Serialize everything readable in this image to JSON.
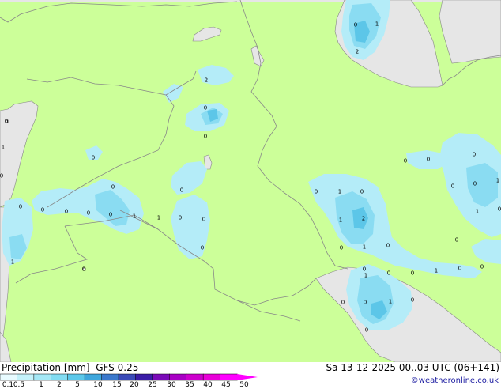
{
  "footer": {
    "product": "Precipitation [mm]  GFS 0.25",
    "run": "Sa 13-12-2025 00..03 UTC (06+141)",
    "credit": "©weatheronline.co.uk"
  },
  "legend": {
    "labels": [
      "0.1",
      "0.5",
      "1",
      "2",
      "5",
      "10",
      "15",
      "20",
      "25",
      "30",
      "35",
      "40",
      "45",
      "50"
    ],
    "colors": [
      "#e8fbff",
      "#c4f2fa",
      "#a4e8f6",
      "#82dcf2",
      "#5cc8ea",
      "#3ea6dc",
      "#3a78cc",
      "#3a4ab8",
      "#3a1ca6",
      "#7a0ab8",
      "#a800c4",
      "#cc00cc",
      "#e800d8",
      "#ff00ff"
    ]
  },
  "map": {
    "colors": {
      "land": "#ccff99",
      "sea": "#e6e6e6",
      "border": "#888888",
      "precip_light": "#b4ecf8",
      "precip_mid": "#8adcf2",
      "precip_heavy": "#5cc6e8"
    },
    "values": [
      "0",
      "1",
      "2",
      "1",
      "0",
      "0",
      "0",
      "0",
      "1",
      "0",
      "0",
      "0",
      "0",
      "0",
      "0",
      "0",
      "1",
      "0",
      "1",
      "0",
      "0",
      "0",
      "0",
      "0",
      "0",
      "1",
      "0",
      "0",
      "0",
      "0",
      "1",
      "0",
      "0",
      "1",
      "2",
      "0",
      "1",
      "0",
      "0",
      "0",
      "0",
      "1",
      "0",
      "1",
      "0",
      "0",
      "1",
      "0",
      "0",
      "0",
      "0",
      "1",
      "2",
      "0",
      "0",
      "0",
      "0",
      "2",
      "0",
      "0",
      "0",
      "0"
    ]
  }
}
